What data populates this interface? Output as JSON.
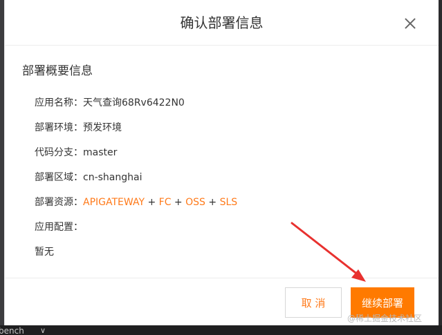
{
  "dialog": {
    "title": "确认部署信息",
    "section_title": "部署概要信息",
    "fields": [
      {
        "label": "应用名称：",
        "value": "天气查询68Rv6422N0"
      },
      {
        "label": "部署环境：",
        "value": "预发环境"
      },
      {
        "label": "代码分支：",
        "value": "master"
      },
      {
        "label": "部署区域：",
        "value": "cn-shanghai"
      },
      {
        "label": "部署资源：",
        "resources": [
          "APIGATEWAY",
          "FC",
          "OSS",
          "SLS"
        ],
        "separator": " + "
      },
      {
        "label": "应用配置：",
        "value": ""
      }
    ],
    "config_value": "暂无",
    "cancel_label": "取 消",
    "continue_label": "继续部署"
  },
  "background": {
    "bottom_text": "bench",
    "chevron": "∨"
  },
  "watermark": "@稀土掘金技术社区",
  "colors": {
    "accent": "#ff7a00",
    "arrow": "#e8312f",
    "text": "#333333"
  }
}
